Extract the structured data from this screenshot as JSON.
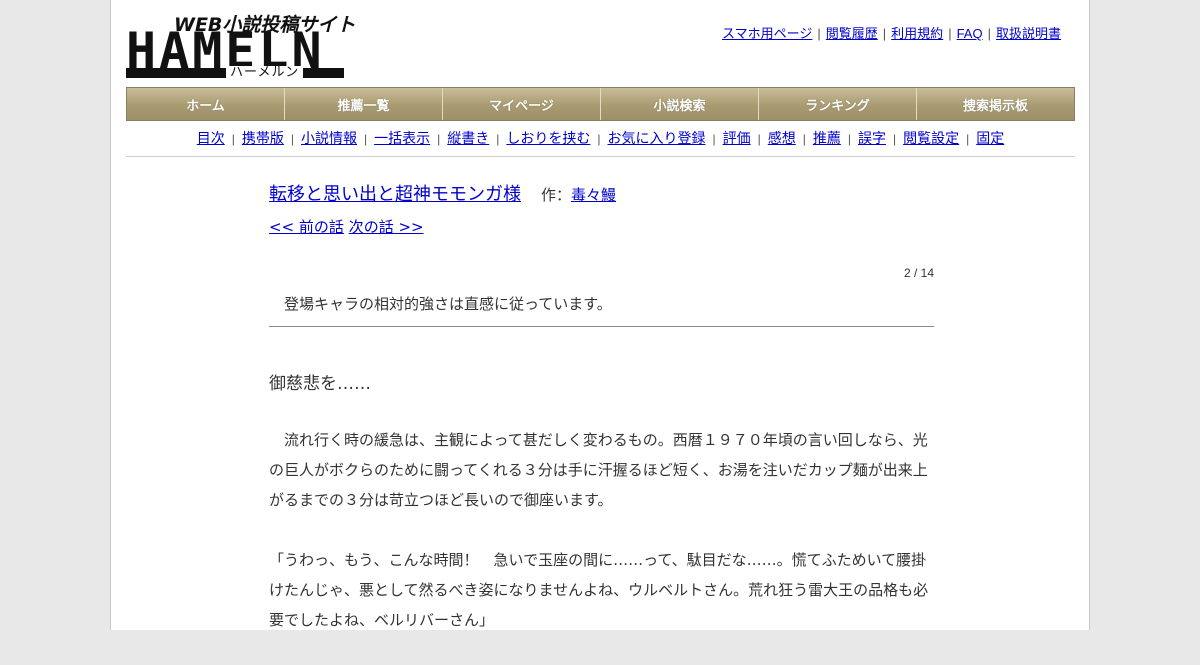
{
  "logo": {
    "tagline": "WEB小説投稿サイト",
    "name": "HAMELN",
    "kana": "ハーメルン"
  },
  "toplinks": [
    "スマホ用ページ",
    "閲覧履歴",
    "利用規約",
    "FAQ",
    "取扱説明書"
  ],
  "nav": [
    "ホーム",
    "推薦一覧",
    "マイページ",
    "小説検索",
    "ランキング",
    "捜索掲示板"
  ],
  "subnav": [
    "目次",
    "携帯版",
    "小説情報",
    "一括表示",
    "縦書き",
    "しおりを挟む",
    "お気に入り登録",
    "評価",
    "感想",
    "推薦",
    "誤字",
    "閲覧設定",
    "固定"
  ],
  "novel": {
    "title": "転移と思い出と超神モモンガ様",
    "author_label": "作：",
    "author": "毒々鰻",
    "prev": "<< 前の話",
    "next": "次の話 >>",
    "count": "2 / 14",
    "preface": "登場キャラの相対的強さは直感に従っています。",
    "chapter_title": "御慈悲を……",
    "paragraphs": [
      "　流れ行く時の緩急は、主観によって甚だしく変わるもの。西暦１９７０年頃の言い回しなら、光の巨人がボクらのために闘ってくれる３分は手に汗握るほど短く、お湯を注いだカップ麺が出来上がるまでの３分は苛立つほど長いので御座います。",
      "「うわっ、もう、こんな時間！　急いで玉座の間に……って、駄目だな……。慌てふためいて腰掛けたんじゃ、悪として然るべき姿になりませんよね、ウルベルトさん。荒れ狂う雷大王の品格も必要でしたよね、ベルリバーさん」"
    ]
  }
}
